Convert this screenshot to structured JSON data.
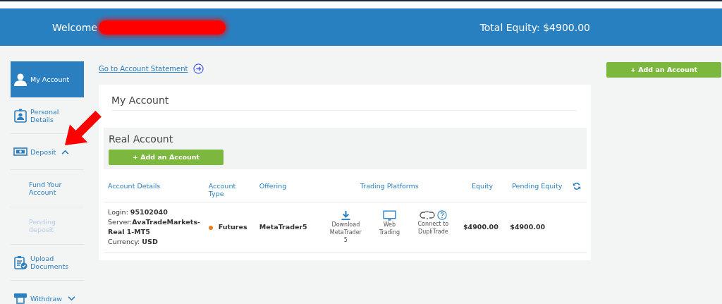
{
  "header": {
    "welcome": "Welcome",
    "total_equity": "Total Equity: $4900.00"
  },
  "sidebar": {
    "items": [
      {
        "kind": "main",
        "label": "My Account",
        "selected": true
      },
      {
        "kind": "main",
        "label": "Personal Details",
        "selected": false
      },
      {
        "kind": "main",
        "label": "Deposit",
        "selected": false,
        "expanded": true,
        "children": [
          {
            "kind": "sub",
            "label": "Fund Your Account",
            "disabled": false
          },
          {
            "kind": "sub",
            "label": "Pending deposit",
            "disabled": true
          }
        ]
      },
      {
        "kind": "main",
        "label": "Upload Documents",
        "selected": false
      },
      {
        "kind": "main",
        "label": "Withdraw",
        "selected": false,
        "expanded": false
      }
    ]
  },
  "statement_link": "Go to Account Statement",
  "card": {
    "title": "My Account",
    "section_title": "Real Account",
    "add_button": "+ Add an Account",
    "table": {
      "columns": [
        "Account Details",
        "Account Type",
        "Offering",
        "Trading Platforms",
        "Equity",
        "Pending Equity"
      ],
      "rows": [
        {
          "details": [
            {
              "label": "Login: ",
              "value": "95102040"
            },
            {
              "label": "Server:",
              "value": "AvaTradeMarkets-Real 1-MT5"
            },
            {
              "label": "Currency: ",
              "value": "USD"
            }
          ],
          "type": "Futures",
          "offering": "MetaTrader5",
          "platforms": [
            {
              "kind": "download",
              "label": "Download MetaTrader 5"
            },
            {
              "kind": "web",
              "label": "Web Trading"
            },
            {
              "kind": "link",
              "label": "Connect to DupliTrade"
            }
          ],
          "equity": "$4900.00",
          "pending_equity": "$4900.00"
        }
      ]
    }
  },
  "side_button": "+ Add an Account"
}
